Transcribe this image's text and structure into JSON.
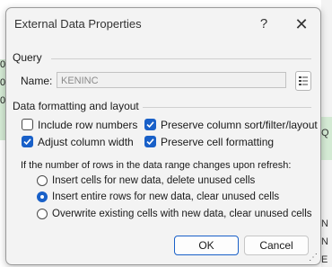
{
  "background": {
    "left_numbers": [
      "0",
      "0",
      "0"
    ],
    "right_labels": [
      "Q",
      "N",
      "N",
      "E"
    ]
  },
  "dialog": {
    "title": "External Data Properties",
    "help_label": "?",
    "close_label": "✕",
    "query": {
      "section_label": "Query",
      "name_label": "Name:",
      "name_value": "KENINC"
    },
    "formatting": {
      "section_label": "Data formatting and layout",
      "options": [
        {
          "label": "Include row numbers",
          "checked": false
        },
        {
          "label": "Preserve column sort/filter/layout",
          "checked": true
        },
        {
          "label": "Adjust column width",
          "checked": true
        },
        {
          "label": "Preserve cell formatting",
          "checked": true
        }
      ]
    },
    "refresh": {
      "prompt": "If the number of rows in the data range changes upon refresh:",
      "options": [
        {
          "label": "Insert cells for new data, delete unused cells",
          "selected": false
        },
        {
          "label": "Insert entire rows for new data, clear unused cells",
          "selected": true
        },
        {
          "label": "Overwrite existing cells with new data, clear unused cells",
          "selected": false
        }
      ]
    },
    "buttons": {
      "ok": "OK",
      "cancel": "Cancel"
    }
  }
}
